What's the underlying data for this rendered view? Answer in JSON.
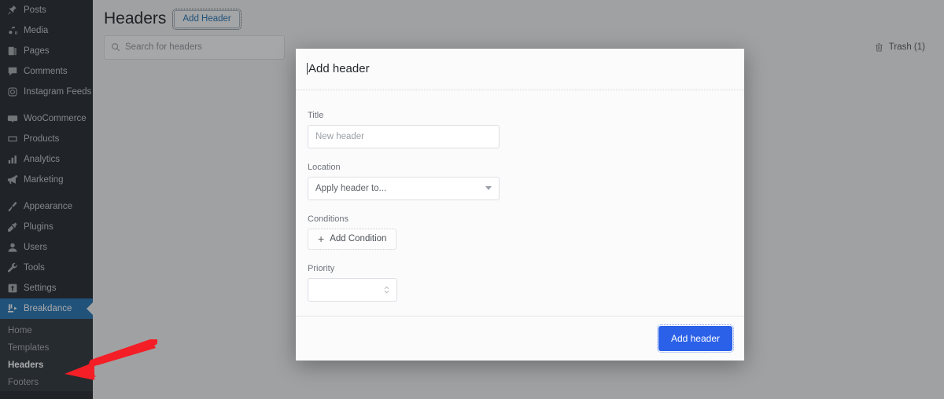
{
  "sidebar": {
    "items": [
      {
        "label": "Posts",
        "icon": "pin-icon"
      },
      {
        "label": "Media",
        "icon": "media-icon"
      },
      {
        "label": "Pages",
        "icon": "pages-icon"
      },
      {
        "label": "Comments",
        "icon": "comments-icon"
      },
      {
        "label": "Instagram Feeds",
        "icon": "instagram-icon"
      },
      {
        "label": "WooCommerce",
        "icon": "woocommerce-icon"
      },
      {
        "label": "Products",
        "icon": "products-icon"
      },
      {
        "label": "Analytics",
        "icon": "analytics-icon"
      },
      {
        "label": "Marketing",
        "icon": "megaphone-icon"
      },
      {
        "label": "Appearance",
        "icon": "brush-icon"
      },
      {
        "label": "Plugins",
        "icon": "plug-icon"
      },
      {
        "label": "Users",
        "icon": "users-icon"
      },
      {
        "label": "Tools",
        "icon": "tools-icon"
      },
      {
        "label": "Settings",
        "icon": "settings-icon"
      }
    ],
    "active": {
      "label": "Breakdance",
      "icon": "breakdance-icon"
    },
    "submenu": [
      {
        "label": "Home",
        "current": false
      },
      {
        "label": "Templates",
        "current": false
      },
      {
        "label": "Headers",
        "current": true
      },
      {
        "label": "Footers",
        "current": false
      }
    ]
  },
  "page": {
    "title": "Headers",
    "add_header_button": "Add Header",
    "search_placeholder": "Search for headers",
    "trash_label": "Trash (1)"
  },
  "modal": {
    "title": "Add header",
    "fields": {
      "title_label": "Title",
      "title_placeholder": "New header",
      "location_label": "Location",
      "location_value": "Apply header to...",
      "conditions_label": "Conditions",
      "add_condition_label": "Add Condition",
      "add_condition_plus": "+",
      "priority_label": "Priority",
      "priority_value": ""
    },
    "submit_label": "Add header"
  },
  "colors": {
    "sidebar_bg": "#23282d",
    "submenu_bg": "#2c3338",
    "active_blue": "#2271b1",
    "primary_button": "#2b61e8",
    "annotation_red": "#f41e26",
    "link_blue": "#2271b1"
  }
}
